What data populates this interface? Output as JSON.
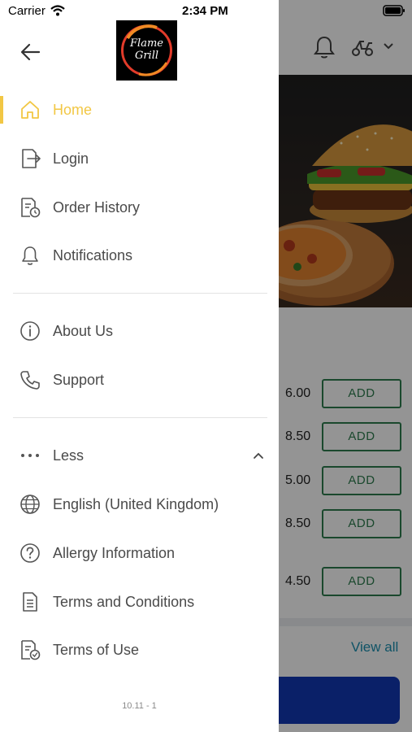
{
  "status_bar": {
    "carrier": "Carrier",
    "time": "2:34 PM"
  },
  "drawer": {
    "logo": {
      "line1": "Flame",
      "line2": "Grill"
    },
    "items": [
      {
        "label": "Home",
        "icon": "home-icon",
        "active": true
      },
      {
        "label": "Login",
        "icon": "login-icon"
      },
      {
        "label": "Order History",
        "icon": "order-history-icon"
      },
      {
        "label": "Notifications",
        "icon": "bell-icon"
      }
    ],
    "secondary": [
      {
        "label": "About Us",
        "icon": "info-icon"
      },
      {
        "label": "Support",
        "icon": "phone-icon"
      }
    ],
    "less_label": "Less",
    "more_items": [
      {
        "label": "English (United Kingdom)",
        "icon": "globe-icon"
      },
      {
        "label": "Allergy Information",
        "icon": "question-icon"
      },
      {
        "label": "Terms and Conditions",
        "icon": "document-icon"
      },
      {
        "label": "Terms of Use",
        "icon": "document-check-icon"
      }
    ],
    "version": "10.11 - 1"
  },
  "background": {
    "prices": [
      "6.00",
      "8.50",
      "5.00",
      "8.50",
      "4.50"
    ],
    "add_label": "ADD",
    "view_all": "View all"
  },
  "colors": {
    "accent": "#f2c744",
    "add_green": "#2e7d4f",
    "link_blue": "#1a8fb0",
    "primary_blue": "#1238b4"
  }
}
